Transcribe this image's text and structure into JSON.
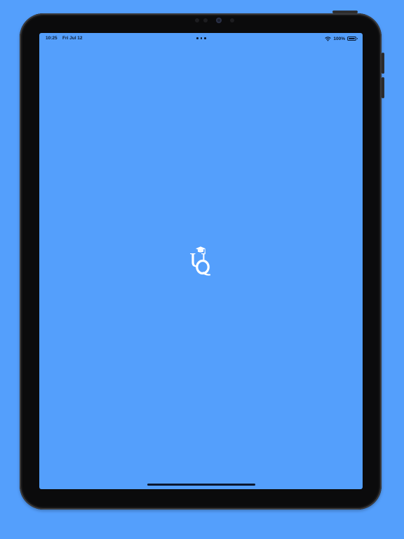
{
  "status_bar": {
    "time": "10:25",
    "date": "Fri Jul 12",
    "battery_percent": "100%",
    "wifi_icon": "wifi-icon",
    "battery_icon": "battery-icon",
    "multitasking_icon": "multitasking-dots-icon"
  },
  "splash": {
    "logo_text": "UQ",
    "logo_icon": "graduation-cap-icon"
  },
  "colors": {
    "background": "#549ffc",
    "device_bezel": "#0b0b0c",
    "status_text": "#0a1a33",
    "logo": "#ffffff"
  }
}
